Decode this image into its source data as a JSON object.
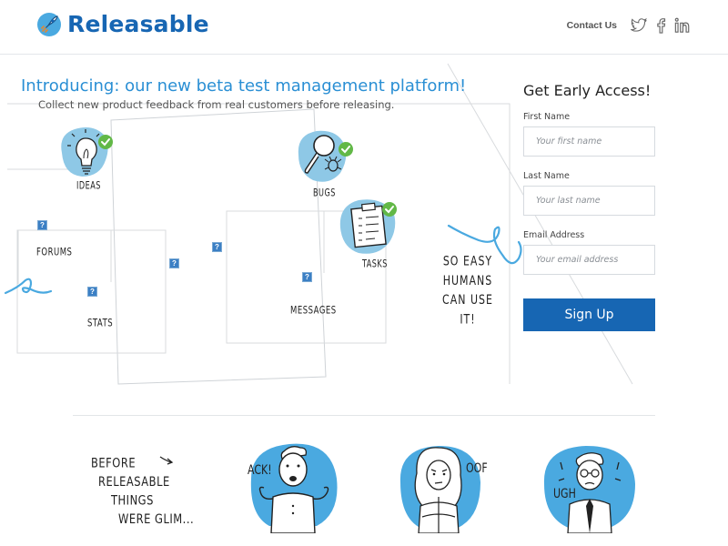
{
  "header": {
    "brand": "Releasable",
    "contact": "Contact Us",
    "social_icons": [
      "twitter-icon",
      "facebook-icon",
      "linkedin-icon"
    ]
  },
  "hero": {
    "title": "Introducing: our new beta test management platform!",
    "subtitle": "Collect new product feedback from real customers before releasing.",
    "features": [
      "IDEAS",
      "BUGS",
      "TASKS"
    ],
    "boxes": [
      "FORUMS",
      "STATS",
      "MESSAGES"
    ],
    "tagline": [
      "SO EASY",
      "HUMANS",
      "CAN USE IT!"
    ],
    "broken_image_glyph": "?"
  },
  "signup": {
    "title": "Get Early Access!",
    "fields": [
      {
        "label": "First Name",
        "placeholder": "Your first name"
      },
      {
        "label": "Last Name",
        "placeholder": "Your last name"
      },
      {
        "label": "Email Address",
        "placeholder": "Your email address"
      }
    ],
    "button": "Sign Up"
  },
  "story": {
    "lines": [
      "BEFORE",
      "RELEASABLE",
      "THINGS",
      "WERE GLIM..."
    ],
    "exclaims": [
      "ACK!",
      "OOF",
      "UGH"
    ]
  },
  "colors": {
    "brand": "#1766b3",
    "accent_blue": "#2a8fd4",
    "blob": "#4aa9e0",
    "check_green": "#62b847"
  }
}
